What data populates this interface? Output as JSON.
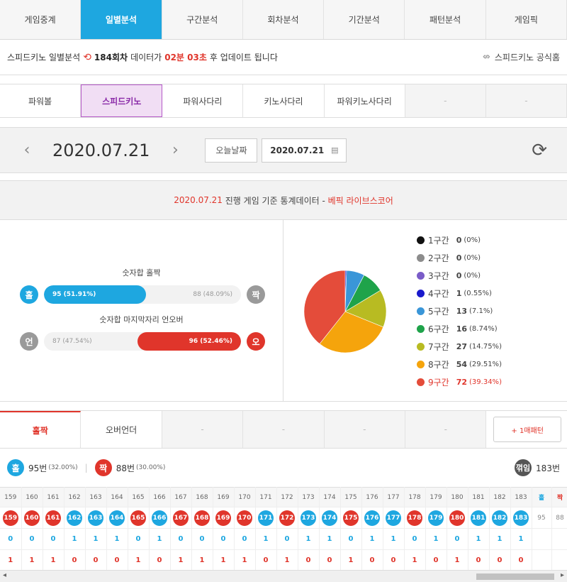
{
  "main_tabs": [
    "게임중계",
    "일별분석",
    "구간분석",
    "회차분석",
    "기간분석",
    "패턴분석",
    "게임픽"
  ],
  "main_tab_active": 1,
  "infobar": {
    "title": "스피드키노 일별분석",
    "round": "184회차",
    "text1": "데이터가",
    "countdown": "02분 03초",
    "text2": "후 업데이트 됩니다",
    "official_link": "스피드키노 공식홈"
  },
  "sub_tabs": [
    "파워볼",
    "스피드키노",
    "파워사다리",
    "키노사다리",
    "파워키노사다리",
    "-",
    "-"
  ],
  "sub_tab_active": 1,
  "datebar": {
    "date": "2020.07.21",
    "today_button": "오늘날짜",
    "date_input": "2020.07.21"
  },
  "stats_header": {
    "date": "2020.07.21",
    "middle": " 진행 게임 기준 통계데이터 - ",
    "brand": "베픽 라이브스코어"
  },
  "oddeven": {
    "caption": "숫자합 홀짝",
    "left_label": "홀",
    "right_label": "짝",
    "left_text": "95 (51.91%)",
    "right_text": "88 (48.09%)",
    "left_fraction": 0.5191
  },
  "overunder": {
    "caption": "숫자합 마지막자리 언오버",
    "left_label": "언",
    "right_label": "오",
    "left_text": "87 (47.54%)",
    "right_text": "96 (52.46%)",
    "right_fraction": 0.5246
  },
  "sections": [
    {
      "label": "1구간",
      "count": "0",
      "pct": "(0%)",
      "value": 0,
      "color": "#111111"
    },
    {
      "label": "2구간",
      "count": "0",
      "pct": "(0%)",
      "value": 0,
      "color": "#8c8c8c"
    },
    {
      "label": "3구간",
      "count": "0",
      "pct": "(0%)",
      "value": 0,
      "color": "#7a5cc8"
    },
    {
      "label": "4구간",
      "count": "1",
      "pct": "(0.55%)",
      "value": 1,
      "color": "#1a1acc"
    },
    {
      "label": "5구간",
      "count": "13",
      "pct": "(7.1%)",
      "value": 13,
      "color": "#3a96d8"
    },
    {
      "label": "6구간",
      "count": "16",
      "pct": "(8.74%)",
      "value": 16,
      "color": "#1fa34a"
    },
    {
      "label": "7구간",
      "count": "27",
      "pct": "(14.75%)",
      "value": 27,
      "color": "#b8bb22"
    },
    {
      "label": "8구간",
      "count": "54",
      "pct": "(29.51%)",
      "value": 54,
      "color": "#f5a40c"
    },
    {
      "label": "9구간",
      "count": "72",
      "pct": "(39.34%)",
      "value": 72,
      "color": "#e44c3a",
      "highlight": true
    }
  ],
  "bottom_tabs": [
    "홀짝",
    "오버언더",
    "-",
    "-",
    "-",
    "-"
  ],
  "pattern_button": "+ 1매패턴",
  "summary": {
    "odd_label": "홀",
    "odd_count": "95번",
    "odd_pct": "(32.00%)",
    "even_label": "짝",
    "even_count": "88번",
    "even_pct": "(30.00%)",
    "turn_label": "꺾임",
    "turn_count": "183번"
  },
  "grid": {
    "rounds": [
      "159",
      "160",
      "161",
      "162",
      "163",
      "164",
      "165",
      "166",
      "167",
      "168",
      "169",
      "170",
      "171",
      "172",
      "173",
      "174",
      "175",
      "176",
      "177",
      "178",
      "179",
      "180",
      "181",
      "182",
      "183"
    ],
    "parity": [
      "e",
      "e",
      "e",
      "o",
      "o",
      "o",
      "e",
      "o",
      "e",
      "e",
      "e",
      "e",
      "o",
      "e",
      "o",
      "o",
      "e",
      "o",
      "o",
      "e",
      "o",
      "e",
      "o",
      "o",
      "o"
    ],
    "row_odd": [
      "0",
      "0",
      "0",
      "1",
      "1",
      "1",
      "0",
      "1",
      "0",
      "0",
      "0",
      "0",
      "1",
      "0",
      "1",
      "1",
      "0",
      "1",
      "1",
      "0",
      "1",
      "0",
      "1",
      "1",
      "1"
    ],
    "row_even": [
      "1",
      "1",
      "1",
      "0",
      "0",
      "0",
      "1",
      "0",
      "1",
      "1",
      "1",
      "1",
      "0",
      "1",
      "0",
      "0",
      "1",
      "0",
      "0",
      "1",
      "0",
      "1",
      "0",
      "0",
      "0"
    ],
    "odd_header": "홀",
    "even_header": "짝",
    "odd_total": "95",
    "even_total": "88"
  },
  "colors": {
    "blue": "#1ea7e0",
    "red": "#e0352b"
  }
}
